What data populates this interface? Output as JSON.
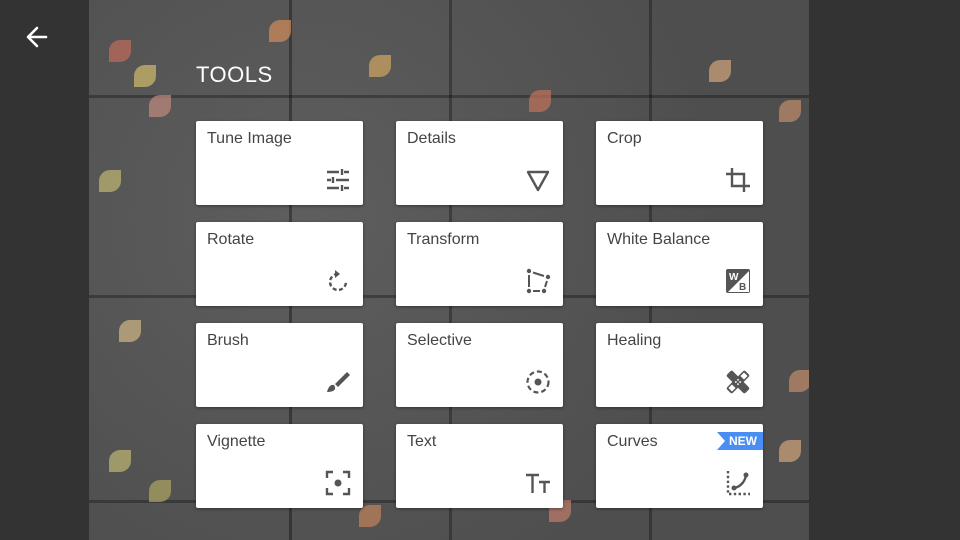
{
  "header": {
    "back_icon": "arrow-left-icon",
    "title": "TOOLS"
  },
  "colors": {
    "background": "#333333",
    "card": "#ffffff",
    "card_text": "#444444",
    "icon": "#555555",
    "badge": "#4a8ef3"
  },
  "tools": [
    {
      "label": "Tune Image",
      "icon": "sliders-icon"
    },
    {
      "label": "Details",
      "icon": "triangle-down-icon"
    },
    {
      "label": "Crop",
      "icon": "crop-icon"
    },
    {
      "label": "Rotate",
      "icon": "rotate-icon"
    },
    {
      "label": "Transform",
      "icon": "perspective-icon"
    },
    {
      "label": "White Balance",
      "icon": "white-balance-icon"
    },
    {
      "label": "Brush",
      "icon": "brush-icon"
    },
    {
      "label": "Selective",
      "icon": "selective-icon"
    },
    {
      "label": "Healing",
      "icon": "healing-icon"
    },
    {
      "label": "Vignette",
      "icon": "vignette-icon"
    },
    {
      "label": "Text",
      "icon": "text-icon"
    },
    {
      "label": "Curves",
      "icon": "curves-icon",
      "badge": "NEW"
    }
  ]
}
